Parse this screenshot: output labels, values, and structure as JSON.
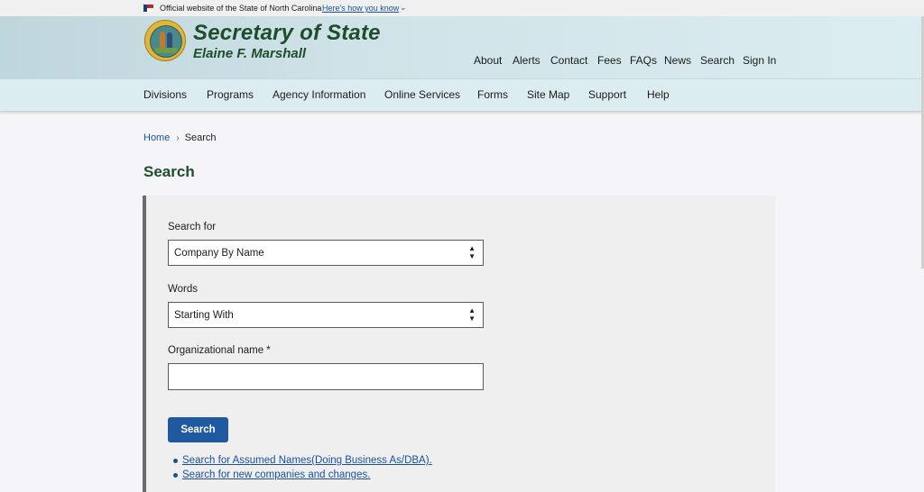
{
  "gov_banner": {
    "official_text": "Official website of the State of North Carolina",
    "how_link": "Here's how you know",
    "chevron_icon": "chevron-down-icon"
  },
  "header": {
    "seal_icon": "state-seal-logo",
    "title": "Secretary of State",
    "subtitle": "Elaine F. Marshall",
    "utility_nav": [
      "About",
      "Alerts",
      "Contact",
      "Fees",
      "FAQs",
      "News",
      "Search",
      "Sign In"
    ]
  },
  "main_nav": [
    "Divisions",
    "Programs",
    "Agency Information",
    "Online Services",
    "Forms",
    "Site Map",
    "Support",
    "Help"
  ],
  "breadcrumb": {
    "home": "Home",
    "separator_icon": "chevron-right-icon",
    "current": "Search"
  },
  "page_title": "Search",
  "form": {
    "search_for": {
      "label": "Search for",
      "value": "Company By Name"
    },
    "words": {
      "label": "Words",
      "value": "Starting With"
    },
    "org_name": {
      "label": "Organizational name *",
      "value": ""
    },
    "search_button": "Search",
    "links": [
      "Search for Assumed Names(Doing Business As/DBA).",
      "Search for new companies and changes."
    ]
  },
  "colors": {
    "brand_green": "#1e4d2b",
    "link_blue": "#1a4f9c",
    "button_blue": "#1f5aa0",
    "panel_bg": "#efefef"
  }
}
